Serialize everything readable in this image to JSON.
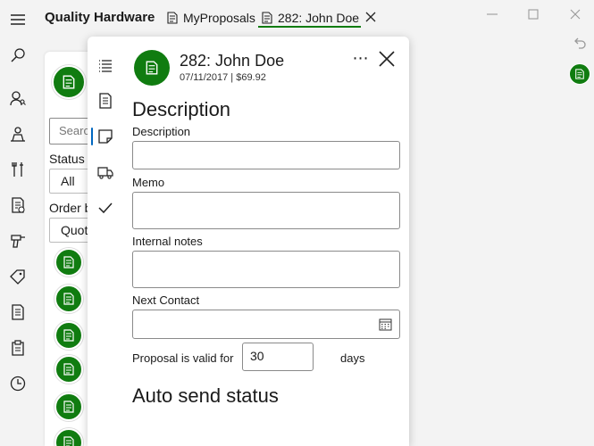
{
  "app": {
    "title": "Quality Hardware"
  },
  "tabs": [
    {
      "label": "MyProposals"
    },
    {
      "label": "282: John Doe"
    }
  ],
  "list": {
    "search_placeholder": "Search",
    "search_visible": "Searc",
    "status_label": "Status",
    "status_value": "All",
    "order_label": "Order b",
    "order_value": "Quot"
  },
  "proposal": {
    "title": "282: John Doe",
    "subtitle": "07/11/2017 | $69.92",
    "more_label": "⋯"
  },
  "form": {
    "section_description": "Description",
    "description_label": "Description",
    "description_value": "",
    "memo_label": "Memo",
    "memo_value": "",
    "internal_notes_label": "Internal notes",
    "internal_notes_value": "",
    "next_contact_label": "Next Contact",
    "next_contact_value": "",
    "valid_prefix": "Proposal is valid for",
    "valid_days": "30",
    "valid_suffix": "days",
    "section_auto_send": "Auto send status"
  },
  "colors": {
    "accent_green": "#107c10",
    "selected_blue": "#0067c0"
  }
}
